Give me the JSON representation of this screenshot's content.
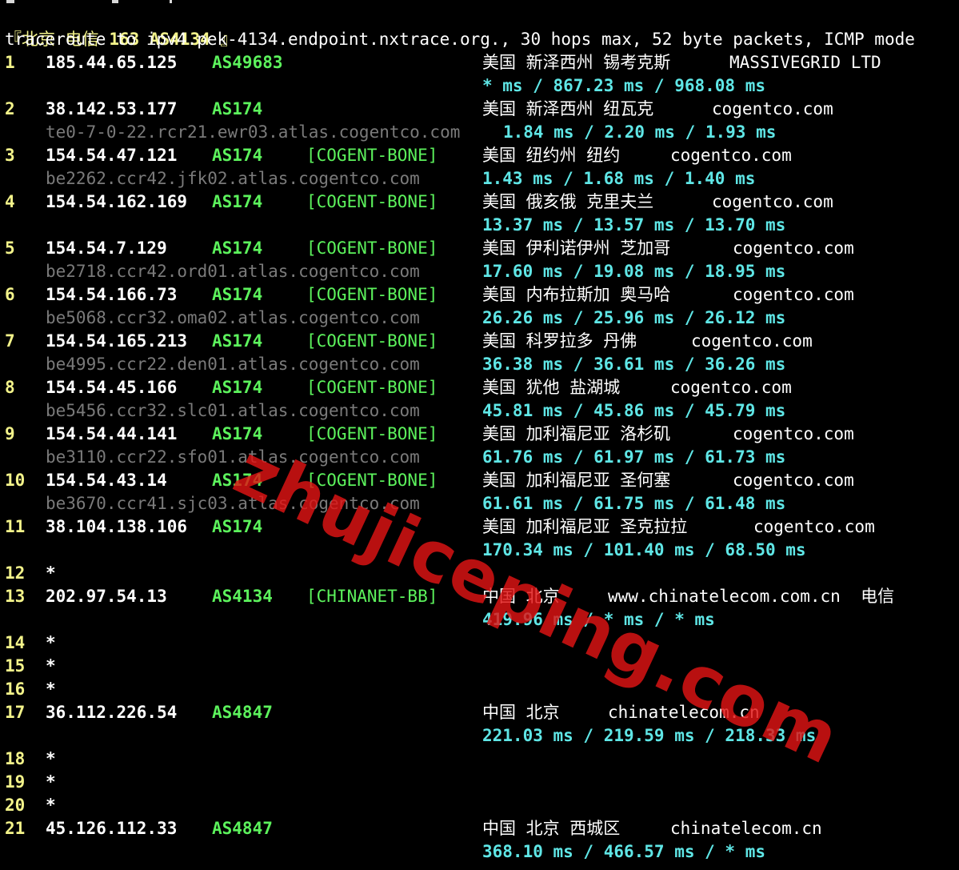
{
  "header": {
    "bracket_open": "『",
    "city": "北京",
    "isp": "电信",
    "code": "163",
    "asn": "AS4134",
    "bracket_close": "』"
  },
  "command": "traceroute to ipv4.pek-4134.endpoint.nxtrace.org., 30 hops max, 52 byte packets, ICMP mode",
  "hops": [
    {
      "n": "1",
      "ip": "185.44.65.125",
      "asn": "AS49683",
      "tag": "",
      "geo": "美国 新泽西州 锡考克斯",
      "org": "MASSIVEGRID LTD",
      "rdns": "",
      "rtt": "* ms / 867.23 ms / 968.08 ms"
    },
    {
      "n": "2",
      "ip": "38.142.53.177",
      "asn": "AS174",
      "tag": "",
      "geo": "美国 新泽西州 纽瓦克",
      "org": "cogentco.com",
      "rdns": "te0-7-0-22.rcr21.ewr03.atlas.cogentco.com",
      "rtt": "1.84 ms / 2.20 ms / 1.93 ms"
    },
    {
      "n": "3",
      "ip": "154.54.47.121",
      "asn": "AS174",
      "tag": "[COGENT-BONE]",
      "geo": "美国 纽约州 纽约",
      "org": "cogentco.com",
      "rdns": "be2262.ccr42.jfk02.atlas.cogentco.com",
      "rtt": "1.43 ms / 1.68 ms / 1.40 ms"
    },
    {
      "n": "4",
      "ip": "154.54.162.169",
      "asn": "AS174",
      "tag": "[COGENT-BONE]",
      "geo": "美国 俄亥俄 克里夫兰",
      "org": "cogentco.com",
      "rdns": "",
      "rtt": "13.37 ms / 13.57 ms / 13.70 ms"
    },
    {
      "n": "5",
      "ip": "154.54.7.129",
      "asn": "AS174",
      "tag": "[COGENT-BONE]",
      "geo": "美国 伊利诺伊州 芝加哥",
      "org": "cogentco.com",
      "rdns": "be2718.ccr42.ord01.atlas.cogentco.com",
      "rtt": "17.60 ms / 19.08 ms / 18.95 ms"
    },
    {
      "n": "6",
      "ip": "154.54.166.73",
      "asn": "AS174",
      "tag": "[COGENT-BONE]",
      "geo": "美国 内布拉斯加 奥马哈",
      "org": "cogentco.com",
      "rdns": "be5068.ccr32.oma02.atlas.cogentco.com",
      "rtt": "26.26 ms / 25.96 ms / 26.12 ms"
    },
    {
      "n": "7",
      "ip": "154.54.165.213",
      "asn": "AS174",
      "tag": "[COGENT-BONE]",
      "geo": "美国 科罗拉多 丹佛",
      "org": "cogentco.com",
      "rdns": "be4995.ccr22.den01.atlas.cogentco.com",
      "rtt": "36.38 ms / 36.61 ms / 36.26 ms"
    },
    {
      "n": "8",
      "ip": "154.54.45.166",
      "asn": "AS174",
      "tag": "[COGENT-BONE]",
      "geo": "美国 犹他 盐湖城",
      "org": "cogentco.com",
      "rdns": "be5456.ccr32.slc01.atlas.cogentco.com",
      "rtt": "45.81 ms / 45.86 ms / 45.79 ms"
    },
    {
      "n": "9",
      "ip": "154.54.44.141",
      "asn": "AS174",
      "tag": "[COGENT-BONE]",
      "geo": "美国 加利福尼亚 洛杉矶",
      "org": "cogentco.com",
      "rdns": "be3110.ccr22.sfo01.atlas.cogentco.com",
      "rtt": "61.76 ms / 61.97 ms / 61.73 ms"
    },
    {
      "n": "10",
      "ip": "154.54.43.14",
      "asn": "AS174",
      "tag": "[COGENT-BONE]",
      "geo": "美国 加利福尼亚 圣何塞",
      "org": "cogentco.com",
      "rdns": "be3670.ccr41.sjc03.atlas.cogentco.com",
      "rtt": "61.61 ms / 61.75 ms / 61.48 ms"
    },
    {
      "n": "11",
      "ip": "38.104.138.106",
      "asn": "AS174",
      "tag": "",
      "geo": "美国 加利福尼亚 圣克拉拉",
      "org": "cogentco.com",
      "rdns": "",
      "rtt": "170.34 ms / 101.40 ms / 68.50 ms"
    },
    {
      "n": "12",
      "ip": "*",
      "asn": "",
      "tag": "",
      "geo": "",
      "org": "",
      "rdns": "",
      "rtt": ""
    },
    {
      "n": "13",
      "ip": "202.97.54.13",
      "asn": "AS4134",
      "tag": "[CHINANET-BB]",
      "geo": "中国 北京",
      "org": "www.chinatelecom.com.cn  电信",
      "rdns": "",
      "rtt": "419.96 ms / * ms / * ms"
    },
    {
      "n": "14",
      "ip": "*",
      "asn": "",
      "tag": "",
      "geo": "",
      "org": "",
      "rdns": "",
      "rtt": ""
    },
    {
      "n": "15",
      "ip": "*",
      "asn": "",
      "tag": "",
      "geo": "",
      "org": "",
      "rdns": "",
      "rtt": ""
    },
    {
      "n": "16",
      "ip": "*",
      "asn": "",
      "tag": "",
      "geo": "",
      "org": "",
      "rdns": "",
      "rtt": ""
    },
    {
      "n": "17",
      "ip": "36.112.226.54",
      "asn": "AS4847",
      "tag": "",
      "geo": "中国 北京",
      "org": "chinatelecom.cn",
      "rdns": "",
      "rtt": "221.03 ms / 219.59 ms / 218.33 ms"
    },
    {
      "n": "18",
      "ip": "*",
      "asn": "",
      "tag": "",
      "geo": "",
      "org": "",
      "rdns": "",
      "rtt": ""
    },
    {
      "n": "19",
      "ip": "*",
      "asn": "",
      "tag": "",
      "geo": "",
      "org": "",
      "rdns": "",
      "rtt": ""
    },
    {
      "n": "20",
      "ip": "*",
      "asn": "",
      "tag": "",
      "geo": "",
      "org": "",
      "rdns": "",
      "rtt": ""
    },
    {
      "n": "21",
      "ip": "45.126.112.33",
      "asn": "AS4847",
      "tag": "",
      "geo": "中国 北京 西城区",
      "org": "chinatelecom.cn",
      "rdns": "",
      "rtt": "368.10 ms / 466.57 ms / * ms"
    }
  ],
  "watermark": "zhujiceping.com",
  "colors": {
    "background": "#000000",
    "hop_number": "#F3F38A",
    "ip": "#FFFFFF",
    "asn": "#5CF25C",
    "rdns": "#7A7A7A",
    "rtt": "#5FE6E6",
    "watermark": "#E11414"
  }
}
